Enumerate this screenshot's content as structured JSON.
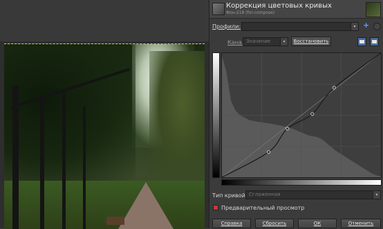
{
  "dialog": {
    "title": "Коррекция цветовых кривых",
    "subtitle": "Фон-218 (for-compose)",
    "profiles_label": "Профили:",
    "profiles_value": "",
    "channel_label": "Канал:",
    "channel_value": "Значение",
    "reset_channel_button": "Восстановить",
    "curve_type_label": "Тип кривой:",
    "curve_type_value": "Сглаженная",
    "preview_label": "Предварительный просмотр",
    "preview_checked": true,
    "buttons": {
      "help": "Справка",
      "reset": "Сбросить",
      "ok": "ОК",
      "cancel": "Отменить"
    }
  },
  "curve": {
    "control_points": [
      [
        0,
        0
      ],
      [
        75,
        52
      ],
      [
        105,
        100
      ],
      [
        145,
        130
      ],
      [
        180,
        184
      ],
      [
        255,
        255
      ]
    ],
    "histogram": [
      255,
      220,
      160,
      140,
      130,
      125,
      120,
      118,
      116,
      115,
      113,
      112,
      110,
      108,
      106,
      104,
      100,
      96,
      92,
      88,
      86,
      84,
      80,
      72,
      64,
      56,
      50,
      44,
      38,
      32,
      26,
      20,
      14,
      8,
      4,
      2
    ]
  },
  "colors": {
    "accent": "#5aa0ff",
    "checkbox": "#c23a3a"
  }
}
